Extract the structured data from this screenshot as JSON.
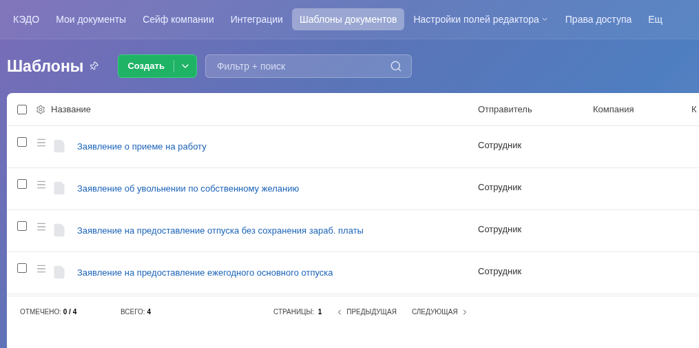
{
  "nav": [
    {
      "label": "КЭДО",
      "selected": false,
      "dropdown": false
    },
    {
      "label": "Мои документы",
      "selected": false,
      "dropdown": false
    },
    {
      "label": "Сейф компании",
      "selected": false,
      "dropdown": false
    },
    {
      "label": "Интеграции",
      "selected": false,
      "dropdown": false
    },
    {
      "label": "Шаблоны документов",
      "selected": true,
      "dropdown": false
    },
    {
      "label": "Настройки полей редактора",
      "selected": false,
      "dropdown": true
    },
    {
      "label": "Права доступа",
      "selected": false,
      "dropdown": false
    },
    {
      "label": "Ещ",
      "selected": false,
      "dropdown": false
    }
  ],
  "page": {
    "title": "Шаблоны",
    "create_button": "Создать",
    "search": {
      "placeholder": "Фильтр + поиск"
    }
  },
  "table": {
    "all_checked": false,
    "columns": [
      "Название",
      "Отправитель",
      "Компания",
      "К"
    ],
    "rows": [
      {
        "name": "Заявление о приеме на работу",
        "sender": "Сотрудник",
        "checked": false
      },
      {
        "name": "Заявление об увольнении по собственному желанию",
        "sender": "Сотрудник",
        "checked": false
      },
      {
        "name": "Заявление на предоставление отпуска без сохранения зараб. платы",
        "sender": "Сотрудник",
        "checked": false
      },
      {
        "name": "Заявление на предоставление ежегодного основного отпуска",
        "sender": "Сотрудник",
        "checked": false
      }
    ]
  },
  "footer": {
    "marked_label": "ОТМЕЧЕНО:",
    "marked_value": "0 / 4",
    "total_label": "ВСЕГО:",
    "total_value": "4",
    "pages_label": "СТРАНИЦЫ:",
    "pages_value": "1",
    "prev": "ПРЕДЫДУЩАЯ",
    "next": "СЛЕДУЮЩАЯ"
  }
}
